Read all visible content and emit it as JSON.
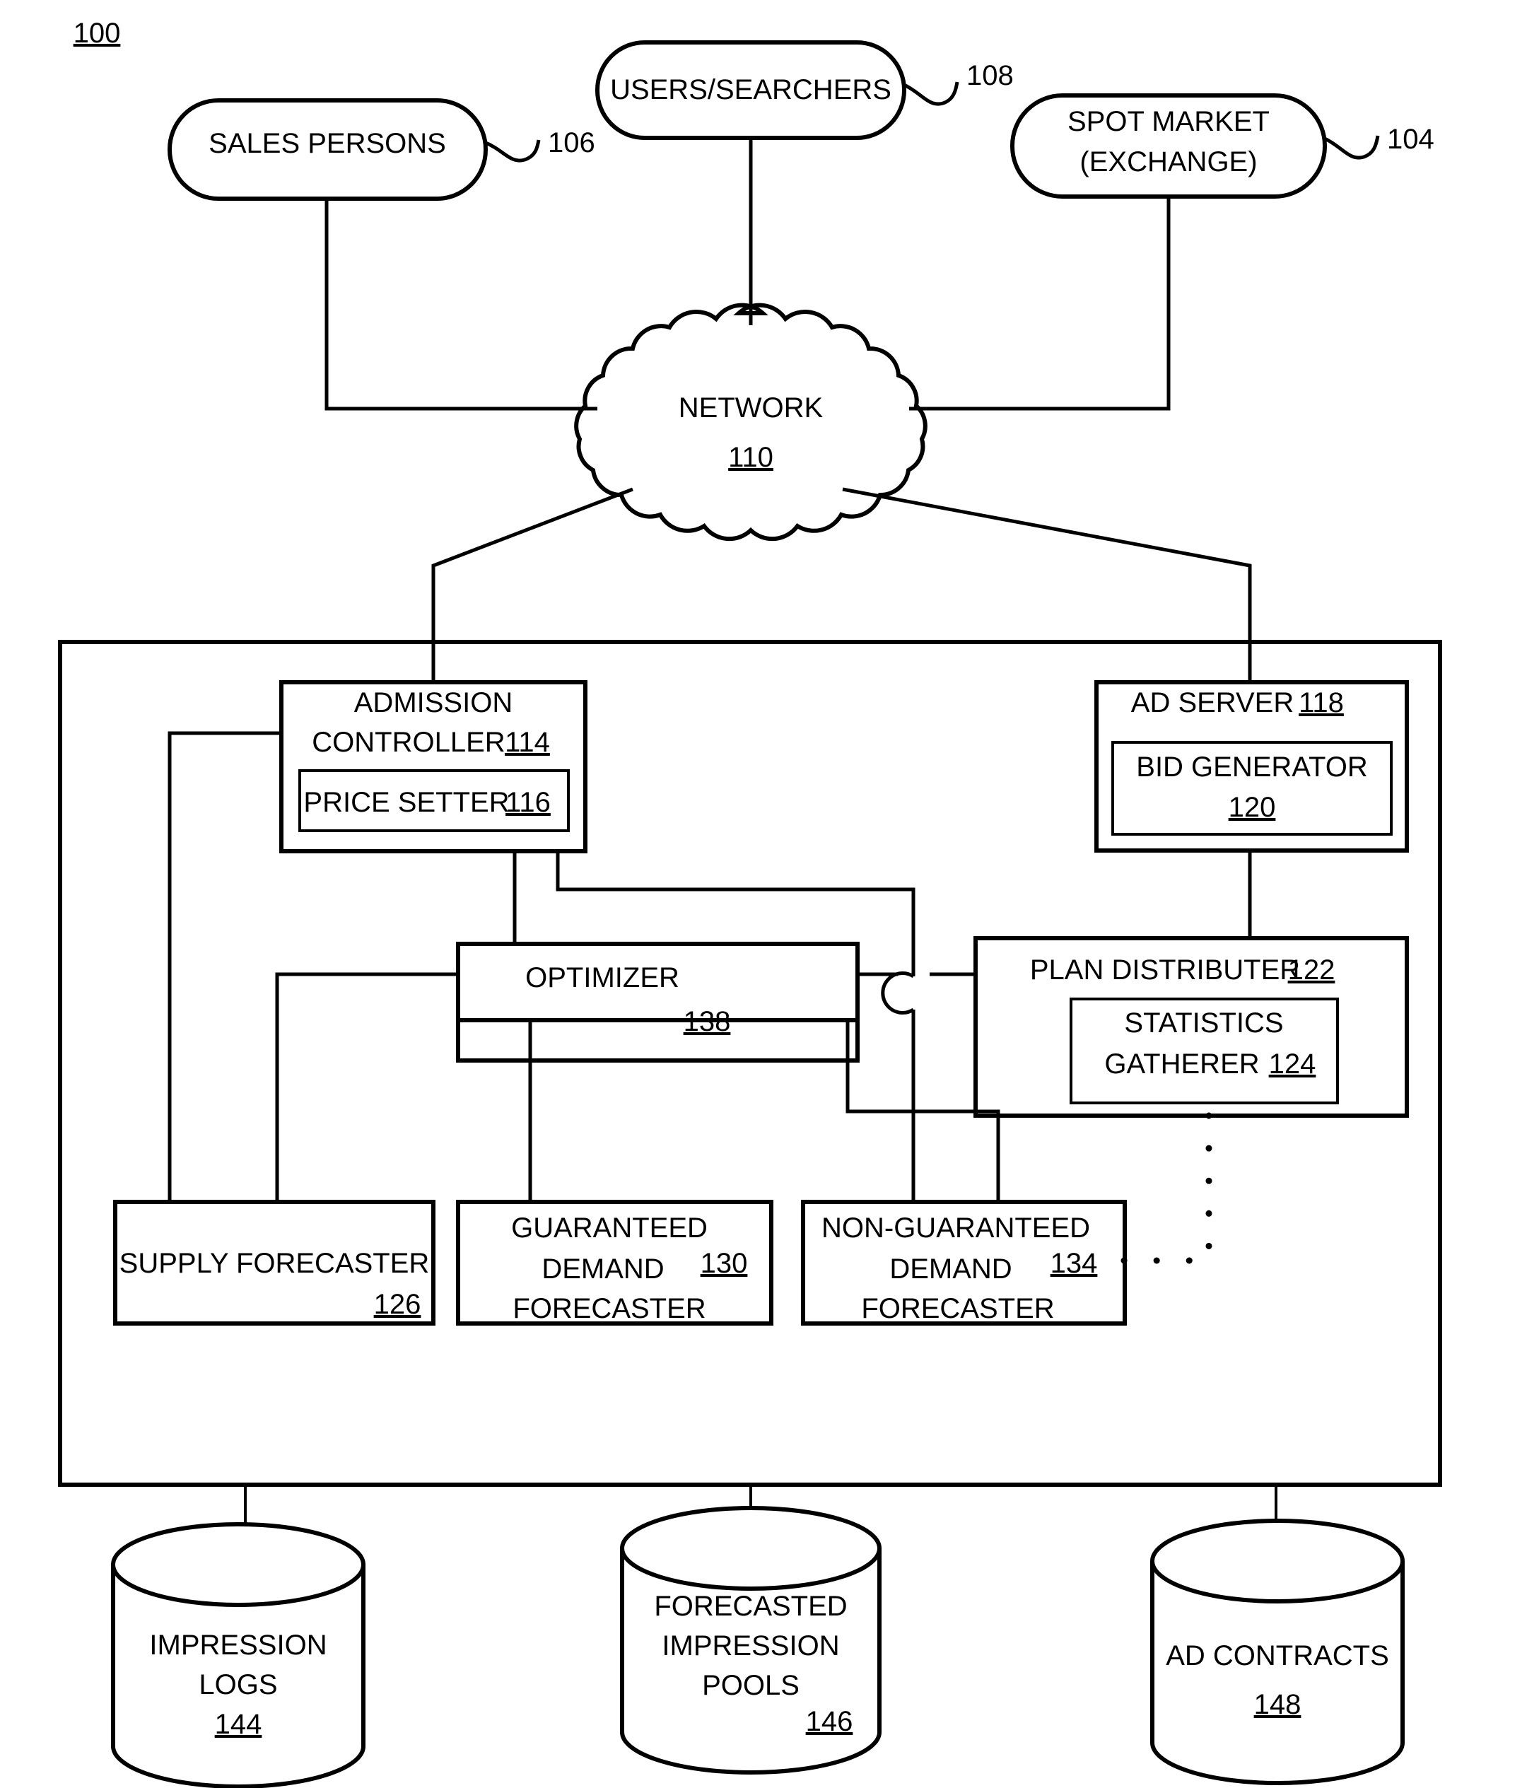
{
  "figure": {
    "figure_number": "100",
    "title": "Ad serving system block diagram"
  },
  "top_nodes": [
    {
      "id": "sales-persons",
      "label": "SALES PERSONS",
      "ref": "106"
    },
    {
      "id": "users-searchers",
      "label": "USERS/SEARCHERS",
      "ref": "108"
    },
    {
      "id": "spot-market",
      "label_line1": "SPOT MARKET",
      "label_line2": "(EXCHANGE)",
      "ref": "104"
    }
  ],
  "network": {
    "label": "NETWORK",
    "ref": "110"
  },
  "system_blocks": {
    "admission_controller": {
      "label_line1": "ADMISSION",
      "label_line2": "CONTROLLER",
      "ref": "114",
      "child": {
        "label": "PRICE SETTER",
        "ref": "116"
      }
    },
    "ad_server": {
      "label": "AD SERVER",
      "ref": "118",
      "child": {
        "label": "BID GENERATOR",
        "ref": "120"
      }
    },
    "optimizer": {
      "label": "OPTIMIZER",
      "ref": "138"
    },
    "plan_distributer": {
      "label": "PLAN DISTRIBUTER",
      "ref": "122",
      "child": {
        "label_line1": "STATISTICS",
        "label_line2": "GATHERER",
        "ref": "124"
      }
    },
    "supply_forecaster": {
      "label": "SUPPLY FORECASTER",
      "ref": "126"
    },
    "guaranteed_demand_forecaster": {
      "label_line1": "GUARANTEED",
      "label_line2": "DEMAND",
      "label_line3": "FORECASTER",
      "ref": "130"
    },
    "non_guaranteed_demand_forecaster": {
      "label_line1": "NON-GUARANTEED",
      "label_line2": "DEMAND",
      "label_line3": "FORECASTER",
      "ref": "134"
    }
  },
  "datastores": [
    {
      "id": "impression-logs",
      "label_line1": "IMPRESSION",
      "label_line2": "LOGS",
      "ref": "144"
    },
    {
      "id": "forecasted-impression-pools",
      "label_line1": "FORECASTED",
      "label_line2": "IMPRESSION",
      "label_line3": "POOLS",
      "ref": "146"
    },
    {
      "id": "ad-contracts",
      "label_line1": "AD CONTRACTS",
      "ref": "148"
    }
  ],
  "colors": {
    "line": "#000000",
    "background": "#ffffff"
  }
}
